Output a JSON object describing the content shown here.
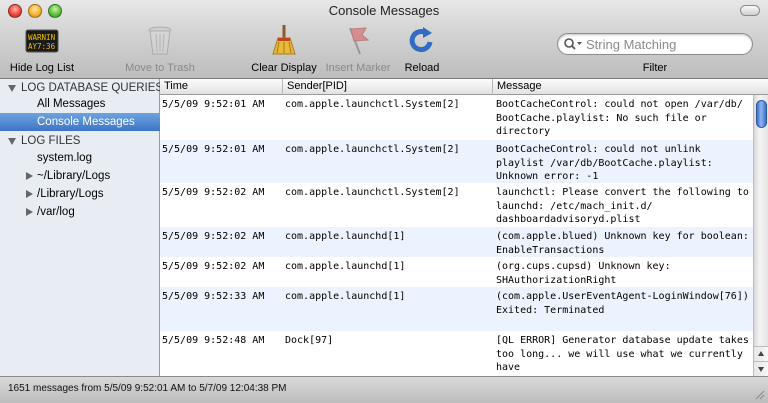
{
  "window": {
    "title": "Console Messages"
  },
  "toolbar": {
    "hide_log_list": "Hide Log List",
    "move_to_trash": "Move to Trash",
    "clear_display": "Clear Display",
    "insert_marker": "Insert Marker",
    "reload": "Reload",
    "search_placeholder": "String Matching",
    "filter": "Filter",
    "log_icon_text_top": "WARNIN",
    "log_icon_text_bottom": "AY7:36"
  },
  "sidebar": {
    "log_database_queries": "LOG DATABASE QUERIES",
    "all_messages": "All Messages",
    "console_messages": "Console Messages",
    "log_files": "LOG FILES",
    "system_log": "system.log",
    "user_library_logs": "~/Library/Logs",
    "library_logs": "/Library/Logs",
    "var_log": "/var/log"
  },
  "table": {
    "headers": {
      "time": "Time",
      "sender": "Sender[PID]",
      "message": "Message"
    },
    "rows": [
      {
        "time": "5/5/09 9:52:01 AM",
        "sender": "com.apple.launchctl.System[2]",
        "message": "BootCacheControl: could not open /var/db/ BootCache.playlist: No such file or directory"
      },
      {
        "time": "5/5/09 9:52:01 AM",
        "sender": "com.apple.launchctl.System[2]",
        "message": "BootCacheControl: could not unlink playlist /var/db/BootCache.playlist: Unknown error: -1"
      },
      {
        "time": "5/5/09 9:52:02 AM",
        "sender": "com.apple.launchctl.System[2]",
        "message": "launchctl: Please convert the following to launchd: /etc/mach_init.d/ dashboardadvisoryd.plist"
      },
      {
        "time": "5/5/09 9:52:02 AM",
        "sender": "com.apple.launchd[1]",
        "message": "(com.apple.blued) Unknown key for boolean: EnableTransactions"
      },
      {
        "time": "5/5/09 9:52:02 AM",
        "sender": "com.apple.launchd[1]",
        "message": "(org.cups.cupsd) Unknown key: SHAuthorizationRight"
      },
      {
        "time": "5/5/09 9:52:33 AM",
        "sender": "com.apple.launchd[1]",
        "message": "(com.apple.UserEventAgent-LoginWindow[76]) Exited: Terminated"
      },
      {
        "time": "5/5/09 9:52:48 AM",
        "sender": "Dock[97]",
        "message": "[QL ERROR] Generator database update takes too long... we will use what we currently have"
      }
    ]
  },
  "status": {
    "text": "1651 messages from 5/5/09 9:52:01 AM to 5/7/09 12:04:38 PM"
  }
}
